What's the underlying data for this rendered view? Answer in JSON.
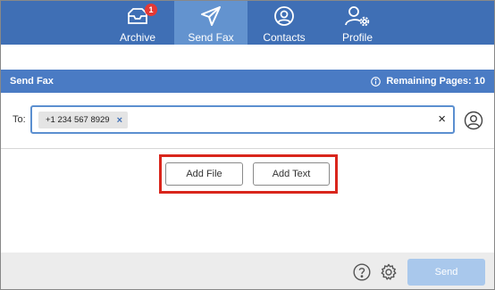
{
  "nav": {
    "items": [
      {
        "label": "Archive",
        "icon": "inbox-icon",
        "badge": "1",
        "active": false
      },
      {
        "label": "Send Fax",
        "icon": "paper-plane-icon",
        "active": true
      },
      {
        "label": "Contacts",
        "icon": "contact-icon",
        "active": false
      },
      {
        "label": "Profile",
        "icon": "user-settings-icon",
        "active": false
      }
    ]
  },
  "header": {
    "title": "Send Fax",
    "remaining": "Remaining Pages: 10"
  },
  "recipient": {
    "label": "To:",
    "chip": "+1 234 567 8929",
    "chip_remove": "×",
    "clear": "×"
  },
  "actions": {
    "add_file": "Add File",
    "add_text": "Add Text"
  },
  "footer": {
    "send": "Send"
  },
  "colors": {
    "nav_bg": "#3f6fb5",
    "nav_active": "#6393cf",
    "header_bg": "#4a7bc4",
    "highlight": "#d9261c",
    "send_disabled": "#a9c8ec"
  }
}
